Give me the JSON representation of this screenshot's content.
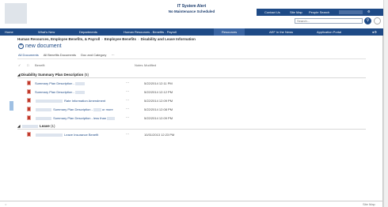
{
  "banner": {
    "alert_title": "IT System Alert",
    "alert_subtitle": "No Maintenance Scheduled"
  },
  "utility": {
    "contact": "Contact Us",
    "sitemap": "Site Map",
    "people": "People Search"
  },
  "search": {
    "placeholder": "Search..."
  },
  "nav": {
    "home": "Home",
    "whats_new": "What's New",
    "departments": "Departments",
    "hr": "Human Resources - Benefits - Payroll",
    "resources": "Resources",
    "aef": "AEF In the News",
    "portal": "Application Portal"
  },
  "breadcrumb": {
    "part1": "Human Resources, Employee Benefits, & Payroll",
    "part2": "Employee Benefits",
    "part3": "Disability and Leave Information"
  },
  "new_document": "new document",
  "views": {
    "all": "All Documents",
    "benefits": "All Benefits Documents",
    "doc_cat": "Doc and Category",
    "more": "···"
  },
  "columns": {
    "name": "Benefit",
    "notes": "Notes",
    "modified": "Modified"
  },
  "groups": [
    {
      "title": "Disability Summary Plan Description",
      "count": "(5)",
      "rows": [
        {
          "name": "Summary Plan Description -",
          "dots": "···",
          "modified": "5/22/2014 12:11 PM"
        },
        {
          "name": "Summary Plan Description -",
          "dots": "···",
          "modified": "5/22/2014 12:12 PM"
        },
        {
          "name": "Rate Information Amendment",
          "dots": "···",
          "modified": "5/22/2014 12:09 PM"
        },
        {
          "name": "Summary Plan Description -",
          "suffix": "or more",
          "dots": "···",
          "modified": "5/22/2014 12:08 PM"
        },
        {
          "name": "Summary Plan Description - less than",
          "dots": "···",
          "modified": "5/22/2014 12:09 PM"
        }
      ]
    },
    {
      "title": "Leave",
      "count": "(1)",
      "rows": [
        {
          "name": "Leave Insurance Benefit",
          "dots": "···",
          "modified": "10/31/2013 12:23 PM"
        }
      ]
    }
  ],
  "footer": {
    "sitemap": "Site Map"
  },
  "colors": {
    "brand_blue": "#1e4a86",
    "pdf_red": "#c0392b"
  }
}
